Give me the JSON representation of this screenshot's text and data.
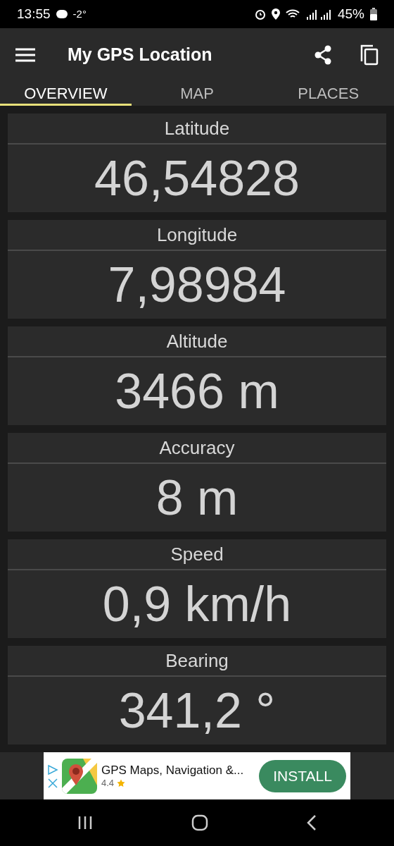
{
  "status_bar": {
    "time": "13:55",
    "temperature": "-2°",
    "battery": "45%"
  },
  "app_bar": {
    "title": "My GPS Location"
  },
  "tabs": [
    {
      "label": "OVERVIEW",
      "selected": true
    },
    {
      "label": "MAP",
      "selected": false
    },
    {
      "label": "PLACES",
      "selected": false
    }
  ],
  "cards": [
    {
      "label": "Latitude",
      "value": "46,54828"
    },
    {
      "label": "Longitude",
      "value": "7,98984"
    },
    {
      "label": "Altitude",
      "value": "3466 m"
    },
    {
      "label": "Accuracy",
      "value": "8 m"
    },
    {
      "label": "Speed",
      "value": "0,9 km/h"
    },
    {
      "label": "Bearing",
      "value": "341,2 °"
    }
  ],
  "ad": {
    "title": "GPS Maps, Navigation &...",
    "rating": "4.4",
    "button": "INSTALL"
  }
}
